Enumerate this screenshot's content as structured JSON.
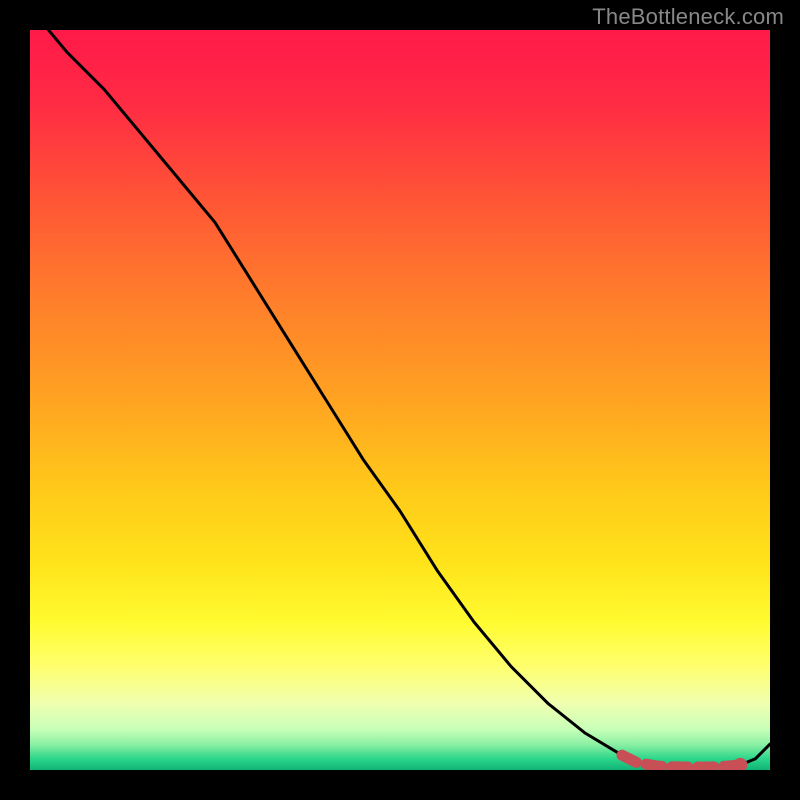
{
  "watermark": "TheBottleneck.com",
  "plot_size": 740,
  "chart_data": {
    "type": "line",
    "title": "",
    "xlabel": "",
    "ylabel": "",
    "xlim": [
      0,
      100
    ],
    "ylim": [
      0,
      100
    ],
    "grid": false,
    "legend": false,
    "x": [
      0,
      5,
      10,
      15,
      20,
      25,
      30,
      35,
      40,
      45,
      50,
      55,
      60,
      65,
      70,
      75,
      80,
      82,
      85,
      88,
      90,
      92,
      94,
      96,
      98,
      100
    ],
    "values": [
      103,
      97,
      92,
      86,
      80,
      74,
      66,
      58,
      50,
      42,
      35,
      27,
      20,
      14,
      9,
      5,
      2,
      1,
      0.5,
      0.4,
      0.4,
      0.4,
      0.5,
      0.7,
      1.5,
      3.5
    ],
    "background_gradient": [
      {
        "offset": 0.0,
        "color": "#ff1a49"
      },
      {
        "offset": 0.1,
        "color": "#ff2b44"
      },
      {
        "offset": 0.22,
        "color": "#ff5236"
      },
      {
        "offset": 0.35,
        "color": "#ff7a2c"
      },
      {
        "offset": 0.5,
        "color": "#ffa321"
      },
      {
        "offset": 0.62,
        "color": "#ffc91a"
      },
      {
        "offset": 0.72,
        "color": "#ffe31a"
      },
      {
        "offset": 0.8,
        "color": "#fffb30"
      },
      {
        "offset": 0.86,
        "color": "#ffff6e"
      },
      {
        "offset": 0.91,
        "color": "#f0ffb0"
      },
      {
        "offset": 0.945,
        "color": "#c8ffb8"
      },
      {
        "offset": 0.965,
        "color": "#8cf0a4"
      },
      {
        "offset": 0.985,
        "color": "#2bd68a"
      },
      {
        "offset": 1.0,
        "color": "#0fb377"
      }
    ],
    "highlight": {
      "color": "#c94f57",
      "stroke_width": 11,
      "dash": "16 10",
      "x_start": 80,
      "x_end": 96,
      "marker_x": 96,
      "marker_r": 7
    }
  }
}
